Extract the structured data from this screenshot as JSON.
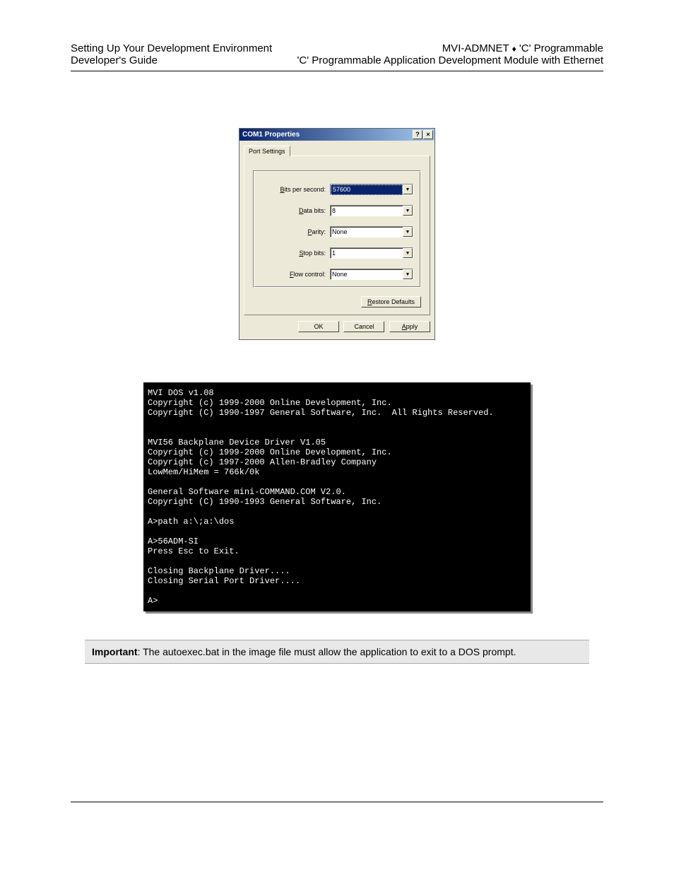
{
  "header": {
    "left_line1": "Setting Up Your Development Environment",
    "left_line2": "Developer's Guide",
    "right_line1_a": "MVI-ADMNET ",
    "right_line1_b": " 'C' Programmable",
    "right_line2": "'C' Programmable Application Development Module with Ethernet"
  },
  "dialog": {
    "title": "COM1 Properties",
    "help_btn": "?",
    "close_btn": "×",
    "tab_label": "Port Settings",
    "fields": {
      "bits_label_pre": "B",
      "bits_label": "its per second:",
      "bits_value": "57600",
      "data_label_pre": "D",
      "data_label": "ata bits:",
      "data_value": "8",
      "parity_label_pre": "P",
      "parity_label": "arity:",
      "parity_value": "None",
      "stop_label_pre": "S",
      "stop_label": "top bits:",
      "stop_value": "1",
      "flow_label_pre": "F",
      "flow_label": "low control:",
      "flow_value": "None"
    },
    "restore_btn_pre": "R",
    "restore_btn": "estore Defaults",
    "ok_btn": "OK",
    "cancel_btn": "Cancel",
    "apply_btn_pre": "A",
    "apply_btn": "pply"
  },
  "terminal": {
    "text": "MVI DOS v1.08\nCopyright (c) 1999-2000 Online Development, Inc.\nCopyright (C) 1990-1997 General Software, Inc.  All Rights Reserved.\n\n\nMVI56 Backplane Device Driver V1.05\nCopyright (c) 1999-2000 Online Development, Inc.\nCopyright (c) 1997-2000 Allen-Bradley Company\nLowMem/HiMem = 766k/0k\n\nGeneral Software mini-COMMAND.COM V2.0.\nCopyright (C) 1990-1993 General Software, Inc.\n\nA>path a:\\;a:\\dos\n\nA>56ADM-SI\nPress Esc to Exit.\n\nClosing Backplane Driver....\nClosing Serial Port Driver....\n\nA>"
  },
  "important": {
    "label": "Important",
    "text": ": The autoexec.bat in the image file must allow the application to exit to a DOS prompt."
  }
}
